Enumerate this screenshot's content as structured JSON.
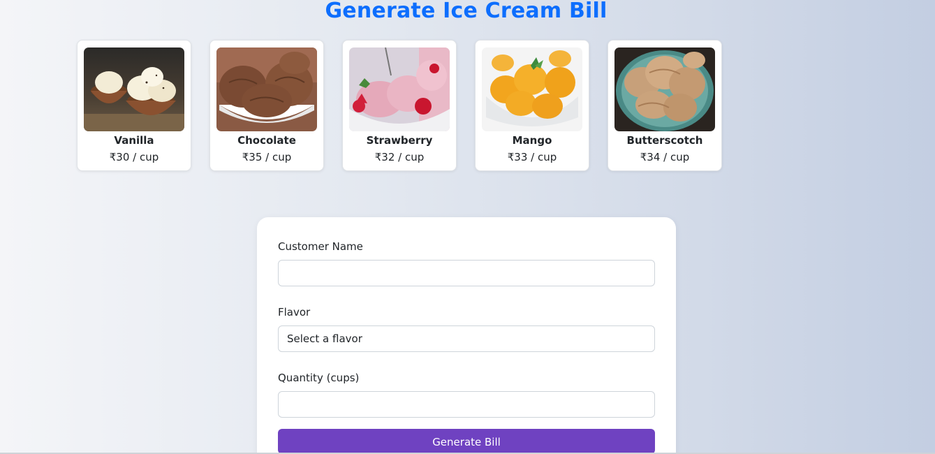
{
  "page": {
    "title": "Generate Ice Cream Bill"
  },
  "flavors": [
    {
      "name": "Vanilla",
      "price": "₹30 / cup",
      "image": "vanilla-ice-cream-photo"
    },
    {
      "name": "Chocolate",
      "price": "₹35 / cup",
      "image": "chocolate-ice-cream-photo"
    },
    {
      "name": "Strawberry",
      "price": "₹32 / cup",
      "image": "strawberry-ice-cream-photo"
    },
    {
      "name": "Mango",
      "price": "₹33 / cup",
      "image": "mango-ice-cream-photo"
    },
    {
      "name": "Butterscotch",
      "price": "₹34 / cup",
      "image": "butterscotch-ice-cream-photo"
    }
  ],
  "form": {
    "customer_name": {
      "label": "Customer Name",
      "value": ""
    },
    "flavor": {
      "label": "Flavor",
      "selected": "Select a flavor"
    },
    "quantity": {
      "label": "Quantity (cups)",
      "value": ""
    },
    "submit_label": "Generate Bill"
  },
  "colors": {
    "title": "#0d6efd",
    "button": "#6f42c1"
  }
}
